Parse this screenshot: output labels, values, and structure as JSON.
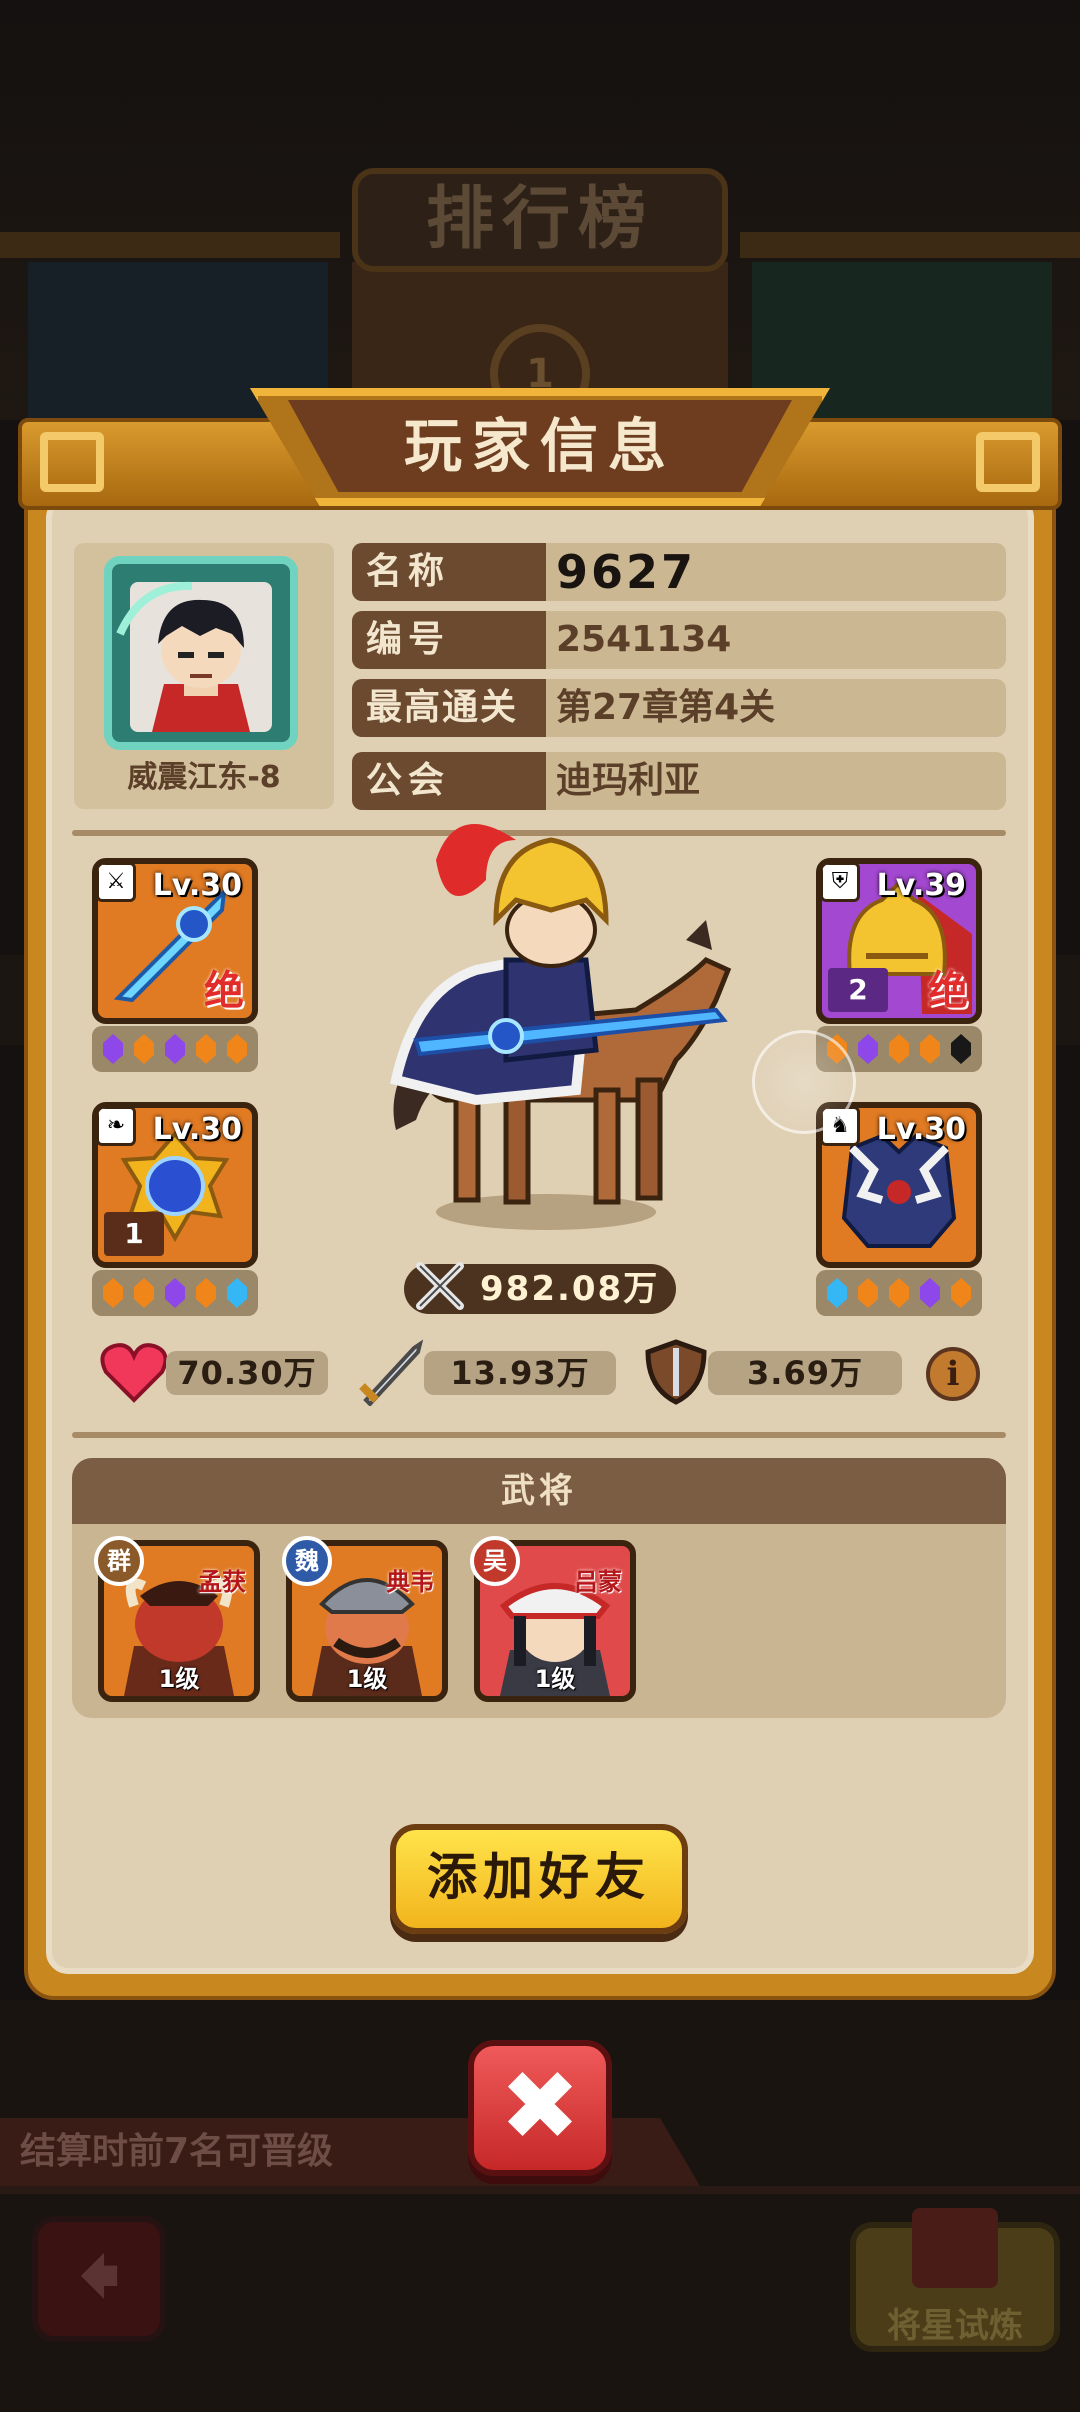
{
  "background": {
    "leaderboard_title": "排行榜",
    "promotion_text": "结算时前7名可晋级",
    "trial_button_label": "将星试炼",
    "rank_badge": "1"
  },
  "dialog": {
    "title": "玩家信息",
    "player": {
      "avatar_name": "威震江东-8",
      "rows": [
        {
          "label": "名称",
          "value": "9627"
        },
        {
          "label": "编号",
          "value": "2541134"
        },
        {
          "label": "最高通关",
          "value": "第27章第4关"
        },
        {
          "label": "公会",
          "value": "迪玛利亚"
        }
      ]
    },
    "equipment": [
      {
        "slot_icon": "sword-icon",
        "level": "Lv.30",
        "grade": "绝",
        "star": "",
        "tile_color": "orange",
        "gems": [
          "purple",
          "orange",
          "purple",
          "orange",
          "orange"
        ]
      },
      {
        "slot_icon": "helmet-icon",
        "level": "Lv.39",
        "grade": "绝",
        "star": "2",
        "tile_color": "purple",
        "gems": [
          "orange",
          "purple",
          "orange",
          "orange",
          "black"
        ]
      },
      {
        "slot_icon": "necklace-icon",
        "level": "Lv.30",
        "grade": "",
        "star": "1",
        "tile_color": "orange",
        "gems": [
          "orange",
          "orange",
          "purple",
          "orange",
          "blue"
        ]
      },
      {
        "slot_icon": "armor-icon",
        "level": "Lv.30",
        "grade": "",
        "star": "",
        "tile_color": "orange",
        "gems": [
          "blue",
          "orange",
          "orange",
          "purple",
          "orange"
        ]
      }
    ],
    "power": "982.08万",
    "stats": {
      "hp": "70.30万",
      "attack": "13.93万",
      "defense": "3.69万"
    },
    "generals_header": "武将",
    "generals": [
      {
        "faction": "群",
        "faction_color": "#8a5a2a",
        "name": "孟获",
        "level": "1级",
        "card_color": "orange"
      },
      {
        "faction": "魏",
        "faction_color": "#2f5aa8",
        "name": "典韦",
        "level": "1级",
        "card_color": "orange"
      },
      {
        "faction": "吴",
        "faction_color": "#c0392b",
        "name": "吕蒙",
        "level": "1级",
        "card_color": "red"
      }
    ],
    "add_friend_label": "添加好友",
    "close_icon": "close-icon"
  }
}
